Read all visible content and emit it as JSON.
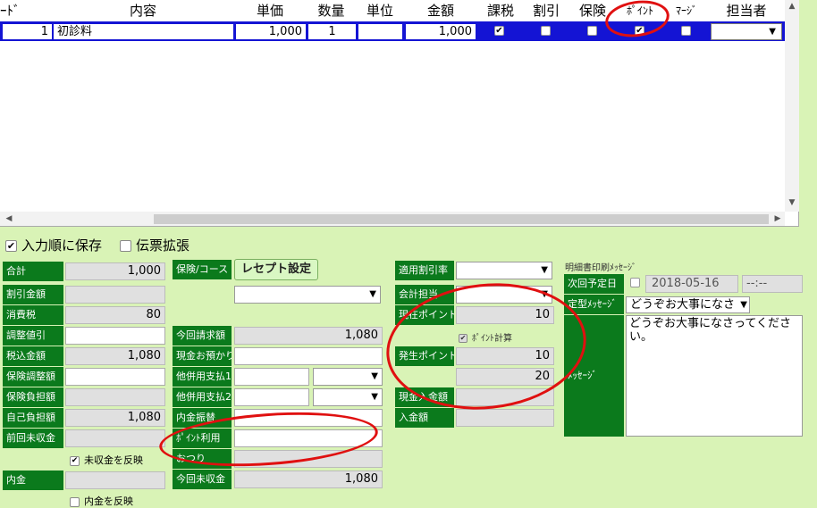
{
  "grid": {
    "headers": [
      "ｰﾄﾞ",
      "内容",
      "単価",
      "数量",
      "単位",
      "金額",
      "課税",
      "割引",
      "保険",
      "ﾎﾟｲﾝﾄ",
      "ﾏｰｼﾞ",
      "担当者"
    ],
    "row": {
      "code": "1",
      "content": "初診料",
      "unit_price": "1,000",
      "quantity": "1",
      "unit": "",
      "amount": "1,000",
      "taxable": true,
      "discount": false,
      "insurance": false,
      "point": true,
      "marge": false,
      "staff": ""
    }
  },
  "options": {
    "input_order_save": "入力順に保存",
    "input_order_checked": true,
    "slip_expand": "伝票拡張",
    "slip_expand_checked": false
  },
  "summary": {
    "total_label": "合計",
    "total": "1,000",
    "discount_label": "割引金額",
    "discount": "",
    "tax_label": "消費税",
    "tax": "80",
    "adjust_label": "調整値引",
    "adjust": "",
    "taxincl_label": "税込金額",
    "taxincl": "1,080",
    "ins_adjust_label": "保険調整額",
    "ins_adjust": "",
    "ins_burden_label": "保険負担額",
    "ins_burden": "",
    "self_burden_label": "自己負担額",
    "self_burden": "1,080",
    "prev_unpaid_label": "前回未収金",
    "prev_unpaid": "",
    "reflect_unpaid": "未収金を反映",
    "reflect_unpaid_checked": true,
    "deposit_label": "内金",
    "deposit": "",
    "reflect_deposit": "内金を反映",
    "reflect_deposit_checked": false
  },
  "billing": {
    "course_label": "保険/コース",
    "receipt_button": "レセプト設定",
    "current_bill_label": "今回請求額",
    "current_bill": "1,080",
    "cash_received_label": "現金お預かり",
    "cash_received": "",
    "other_pay1_label": "他併用支払1",
    "other_pay1": "",
    "other_pay2_label": "他併用支払2",
    "other_pay2": "",
    "deposit_transfer_label": "内金振替",
    "deposit_transfer": "",
    "point_use_label": "ﾎﾟｲﾝﾄ利用",
    "point_use": "",
    "change_label": "おつり",
    "change": "",
    "current_unpaid_label": "今回未収金",
    "current_unpaid": "1,080"
  },
  "points": {
    "discount_rate_label": "適用割引率",
    "staff_label": "会計担当",
    "current_points_label": "現在ポイント",
    "current_points": "10",
    "point_calc": "ﾎﾟｲﾝﾄ計算",
    "point_calc_checked": true,
    "generated_label": "発生ポイント",
    "generated": "10",
    "generated2": "20",
    "cash_in_label": "現金入金額",
    "cash_in": "",
    "in_amount_label": "入金額",
    "in_amount": ""
  },
  "message": {
    "section_title": "明細書印刷ﾒｯｾｰｼﾞ",
    "next_date_label": "次回予定日",
    "next_date": "2018-05-16",
    "next_time": "--:--",
    "template_label": "定型ﾒｯｾｰｼﾞ",
    "template_value": "どうぞお大事になさ",
    "message_label": "ﾒｯｾｰｼﾞ",
    "message_text": "どうぞお大事になさってください。"
  },
  "colors": {
    "label_bg": "#0b7a1c",
    "row_highlight": "#1414d4",
    "page_bg": "#d9f3b6",
    "annotation": "#e01010"
  }
}
